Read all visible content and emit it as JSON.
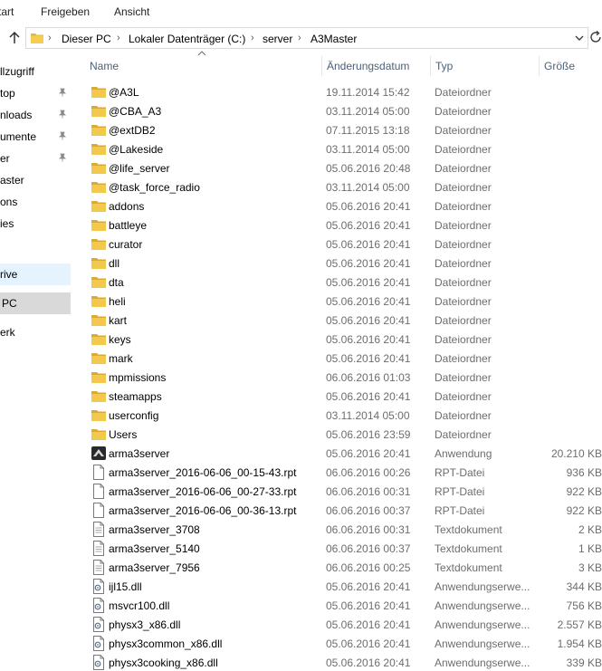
{
  "ribbon": {
    "tabs": [
      "tart",
      "Freigeben",
      "Ansicht"
    ]
  },
  "address": {
    "crumbs": [
      "Dieser PC",
      "Lokaler Datenträger (C:)",
      "server",
      "A3Master"
    ]
  },
  "nav": {
    "items": [
      {
        "label": "llzugriff",
        "pinned": false
      },
      {
        "label": "top",
        "pinned": true
      },
      {
        "label": "nloads",
        "pinned": true
      },
      {
        "label": "umente",
        "pinned": true
      },
      {
        "label": "er",
        "pinned": true
      },
      {
        "label": "aster",
        "pinned": false
      },
      {
        "label": "ons",
        "pinned": false
      },
      {
        "label": "ies",
        "pinned": false
      },
      {
        "label": "rive",
        "pinned": false
      },
      {
        "label": "PC",
        "pinned": false
      },
      {
        "label": "erk",
        "pinned": false
      }
    ]
  },
  "columns": {
    "name": "Name",
    "date": "Änderungsdatum",
    "type": "Typ",
    "size": "Größe"
  },
  "files": [
    {
      "name": "@A3L",
      "date": "19.11.2014 15:42",
      "type": "Dateiordner",
      "size": "",
      "icon": "folder-icon"
    },
    {
      "name": "@CBA_A3",
      "date": "03.11.2014 05:00",
      "type": "Dateiordner",
      "size": "",
      "icon": "folder-icon"
    },
    {
      "name": "@extDB2",
      "date": "07.11.2015 13:18",
      "type": "Dateiordner",
      "size": "",
      "icon": "folder-icon"
    },
    {
      "name": "@Lakeside",
      "date": "03.11.2014 05:00",
      "type": "Dateiordner",
      "size": "",
      "icon": "folder-icon"
    },
    {
      "name": "@life_server",
      "date": "05.06.2016 20:48",
      "type": "Dateiordner",
      "size": "",
      "icon": "folder-icon"
    },
    {
      "name": "@task_force_radio",
      "date": "03.11.2014 05:00",
      "type": "Dateiordner",
      "size": "",
      "icon": "folder-icon"
    },
    {
      "name": "addons",
      "date": "05.06.2016 20:41",
      "type": "Dateiordner",
      "size": "",
      "icon": "folder-icon"
    },
    {
      "name": "battleye",
      "date": "05.06.2016 20:41",
      "type": "Dateiordner",
      "size": "",
      "icon": "folder-icon"
    },
    {
      "name": "curator",
      "date": "05.06.2016 20:41",
      "type": "Dateiordner",
      "size": "",
      "icon": "folder-icon"
    },
    {
      "name": "dll",
      "date": "05.06.2016 20:41",
      "type": "Dateiordner",
      "size": "",
      "icon": "folder-icon"
    },
    {
      "name": "dta",
      "date": "05.06.2016 20:41",
      "type": "Dateiordner",
      "size": "",
      "icon": "folder-icon"
    },
    {
      "name": "heli",
      "date": "05.06.2016 20:41",
      "type": "Dateiordner",
      "size": "",
      "icon": "folder-icon"
    },
    {
      "name": "kart",
      "date": "05.06.2016 20:41",
      "type": "Dateiordner",
      "size": "",
      "icon": "folder-icon"
    },
    {
      "name": "keys",
      "date": "05.06.2016 20:41",
      "type": "Dateiordner",
      "size": "",
      "icon": "folder-icon"
    },
    {
      "name": "mark",
      "date": "05.06.2016 20:41",
      "type": "Dateiordner",
      "size": "",
      "icon": "folder-icon"
    },
    {
      "name": "mpmissions",
      "date": "06.06.2016 01:03",
      "type": "Dateiordner",
      "size": "",
      "icon": "folder-icon"
    },
    {
      "name": "steamapps",
      "date": "05.06.2016 20:41",
      "type": "Dateiordner",
      "size": "",
      "icon": "folder-icon"
    },
    {
      "name": "userconfig",
      "date": "03.11.2014 05:00",
      "type": "Dateiordner",
      "size": "",
      "icon": "folder-icon"
    },
    {
      "name": "Users",
      "date": "05.06.2016 23:59",
      "type": "Dateiordner",
      "size": "",
      "icon": "folder-icon"
    },
    {
      "name": "arma3server",
      "date": "05.06.2016 20:41",
      "type": "Anwendung",
      "size": "20.210 KB",
      "icon": "app-icon"
    },
    {
      "name": "arma3server_2016-06-06_00-15-43.rpt",
      "date": "06.06.2016 00:26",
      "type": "RPT-Datei",
      "size": "936 KB",
      "icon": "file-icon"
    },
    {
      "name": "arma3server_2016-06-06_00-27-33.rpt",
      "date": "06.06.2016 00:31",
      "type": "RPT-Datei",
      "size": "922 KB",
      "icon": "file-icon"
    },
    {
      "name": "arma3server_2016-06-06_00-36-13.rpt",
      "date": "06.06.2016 00:37",
      "type": "RPT-Datei",
      "size": "922 KB",
      "icon": "file-icon"
    },
    {
      "name": "arma3server_3708",
      "date": "06.06.2016 00:31",
      "type": "Textdokument",
      "size": "2 KB",
      "icon": "text-file-icon"
    },
    {
      "name": "arma3server_5140",
      "date": "06.06.2016 00:37",
      "type": "Textdokument",
      "size": "1 KB",
      "icon": "text-file-icon"
    },
    {
      "name": "arma3server_7956",
      "date": "06.06.2016 00:25",
      "type": "Textdokument",
      "size": "3 KB",
      "icon": "text-file-icon"
    },
    {
      "name": "ijl15.dll",
      "date": "05.06.2016 20:41",
      "type": "Anwendungserwe...",
      "size": "344 KB",
      "icon": "dll-icon"
    },
    {
      "name": "msvcr100.dll",
      "date": "05.06.2016 20:41",
      "type": "Anwendungserwe...",
      "size": "756 KB",
      "icon": "dll-icon"
    },
    {
      "name": "physx3_x86.dll",
      "date": "05.06.2016 20:41",
      "type": "Anwendungserwe...",
      "size": "2.557 KB",
      "icon": "dll-icon"
    },
    {
      "name": "physx3common_x86.dll",
      "date": "05.06.2016 20:41",
      "type": "Anwendungserwe...",
      "size": "1.954 KB",
      "icon": "dll-icon"
    },
    {
      "name": "physx3cooking_x86.dll",
      "date": "05.06.2016 20:41",
      "type": "Anwendungserwe...",
      "size": "339 KB",
      "icon": "dll-icon"
    }
  ],
  "colors": {
    "folder": "#e8b835",
    "header_text": "#4c607a",
    "meta_text": "#6d6d6d",
    "nav_selected": "#d9d9d9",
    "nav_hover": "#e5f3ff"
  }
}
